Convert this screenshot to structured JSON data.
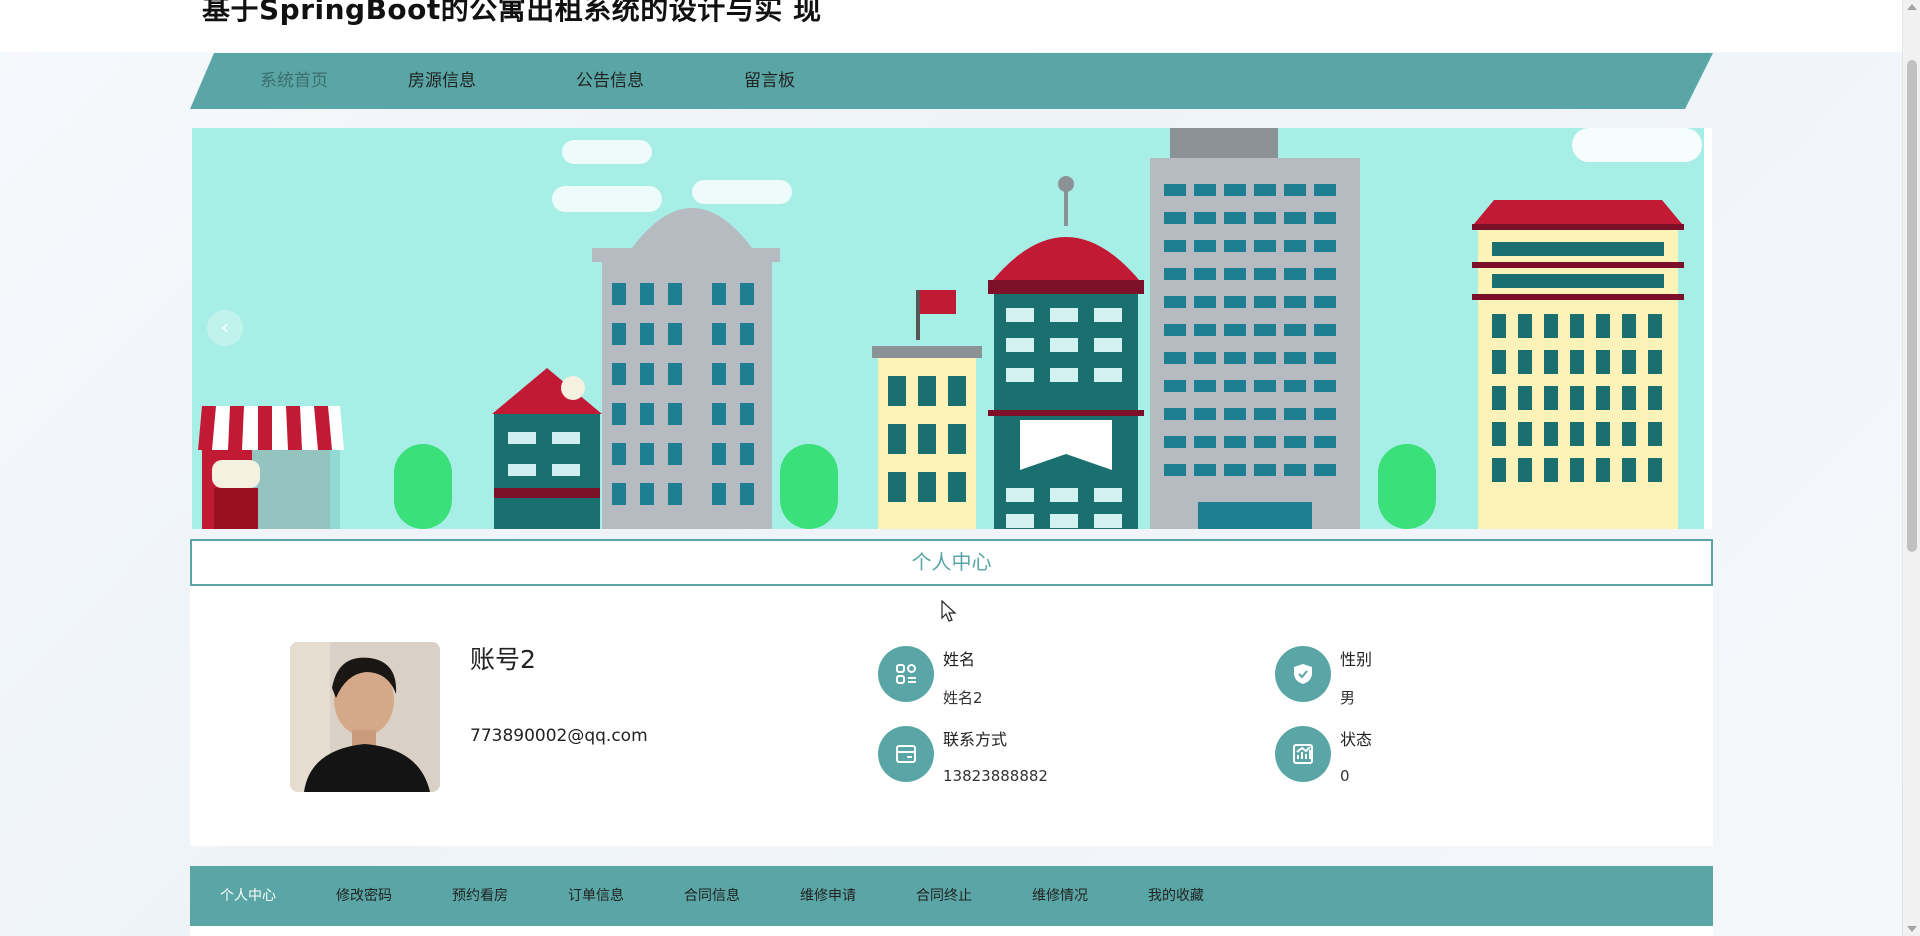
{
  "site": {
    "title": "基于SpringBoot的公寓出租系统的设计与实 现"
  },
  "nav": {
    "items": [
      {
        "label": "系统首页",
        "active": true
      },
      {
        "label": "房源信息"
      },
      {
        "label": "公告信息"
      },
      {
        "label": "留言板"
      }
    ]
  },
  "banner": {
    "prev_symbol": "‹"
  },
  "section": {
    "title": "个人中心"
  },
  "profile": {
    "account": "账号2",
    "email": "773890002@qq.com",
    "fields": {
      "name": {
        "label": "姓名",
        "value": "姓名2",
        "icon": "apps-icon"
      },
      "gender": {
        "label": "性别",
        "value": "男",
        "icon": "shield-icon"
      },
      "phone": {
        "label": "联系方式",
        "value": "13823888882",
        "icon": "wallet-icon"
      },
      "status": {
        "label": "状态",
        "value": "0",
        "icon": "chart-icon"
      }
    }
  },
  "subnav": {
    "items": [
      {
        "label": "个人中心",
        "active": true
      },
      {
        "label": "修改密码"
      },
      {
        "label": "预约看房"
      },
      {
        "label": "订单信息"
      },
      {
        "label": "合同信息"
      },
      {
        "label": "维修申请"
      },
      {
        "label": "合同终止"
      },
      {
        "label": "维修情况"
      },
      {
        "label": "我的收藏"
      }
    ]
  },
  "colors": {
    "accent": "#5aa6a6",
    "banner_sky": "#a6eee6"
  }
}
